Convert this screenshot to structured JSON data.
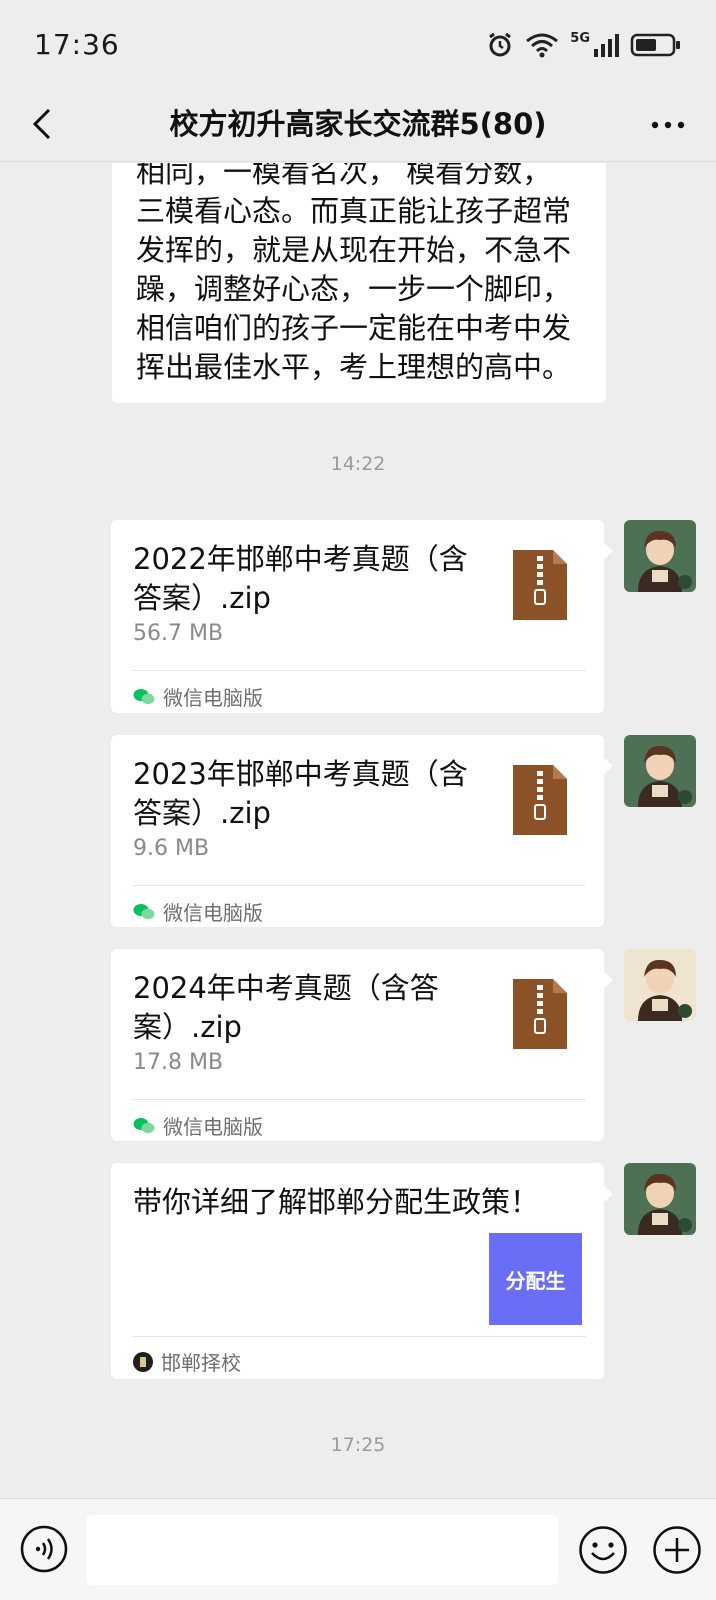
{
  "status_bar": {
    "time": "17:36",
    "network": "5G",
    "icons": [
      "alarm-icon",
      "wifi-icon",
      "signal-icon",
      "battery-icon"
    ]
  },
  "header": {
    "title": "校方初升高家长交流群5(80)",
    "back_icon": "chevron-left-icon",
    "more_icon": "more-dots-icon"
  },
  "messages": {
    "partial_text": [
      "相同，一模看名次， 模看分数，",
      "三模看心态。而真正能让孩子超常",
      "发挥的，就是从现在开始，不急不",
      "躁，调整好心态，一步一个脚印，",
      "相信咱们的孩子一定能在中考中发",
      "挥出最佳水平，考上理想的高中。"
    ],
    "time_1": "14:22",
    "files": [
      {
        "name": "2022年邯郸中考真题（含答案）.zip",
        "size": "56.7 MB",
        "source": "微信电脑版"
      },
      {
        "name": "2023年邯郸中考真题（含答案）.zip",
        "size": "9.6 MB",
        "source": "微信电脑版"
      },
      {
        "name": "2024年中考真题（含答案）.zip",
        "size": "17.8 MB",
        "source": "微信电脑版"
      }
    ],
    "link": {
      "title": "带你详细了解邯郸分配生政策！",
      "thumb_text": "分配生",
      "source": "邯郸择校"
    },
    "time_2": "17:25"
  },
  "input": {
    "placeholder": ""
  },
  "colors": {
    "background": "#ededed",
    "bubble": "#ffffff",
    "zip_icon": "#8b5228",
    "wechat_green": "#07c160",
    "link_thumb": "#6a6ef6"
  }
}
